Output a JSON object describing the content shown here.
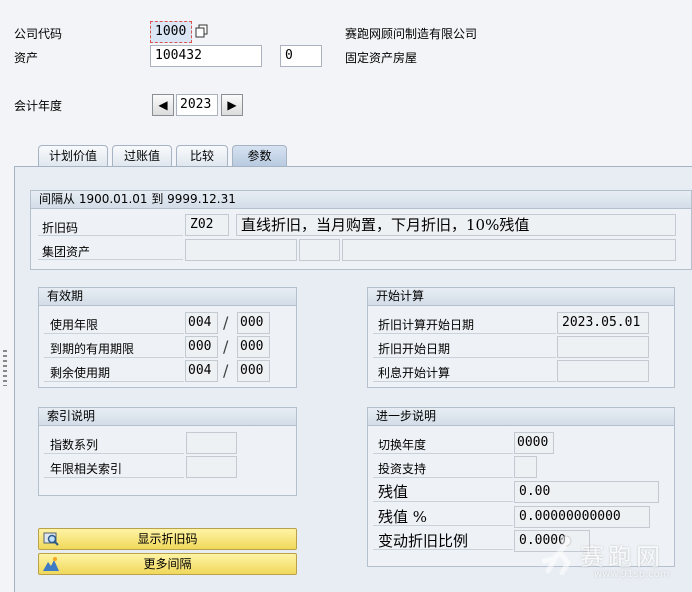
{
  "header": {
    "company_code_label": "公司代码",
    "company_code_value": "1000",
    "company_name": "赛跑网顾问制造有限公司",
    "asset_label": "资产",
    "asset_value": "100432",
    "asset_sub_value": "0",
    "asset_description": "固定资产房屋",
    "fiscal_year_label": "会计年度",
    "fiscal_year_value": "2023",
    "prev_arrow": "◀",
    "next_arrow": "▶"
  },
  "tabs": [
    {
      "label": "计划价值",
      "active": false
    },
    {
      "label": "过账值",
      "active": false
    },
    {
      "label": "比较",
      "active": false
    },
    {
      "label": "参数",
      "active": true
    }
  ],
  "interval": {
    "title": "间隔从 1900.01.01 到 9999.12.31",
    "depr_key_label": "折旧码",
    "depr_key_value": "Z02",
    "depr_key_desc": "直线折旧，当月购置，下月折旧，10%残值",
    "group_asset_label": "集团资产"
  },
  "validity": {
    "title": "有效期",
    "rows": [
      {
        "label": "使用年限",
        "years": "004",
        "periods": "000"
      },
      {
        "label": "到期的有用期限",
        "years": "000",
        "periods": "000"
      },
      {
        "label": "剩余使用期",
        "years": "004",
        "periods": "000"
      }
    ],
    "separator": "/"
  },
  "start_calc": {
    "title": "开始计算",
    "rows": [
      {
        "label": "折旧计算开始日期",
        "value": "2023.05.01"
      },
      {
        "label": "折旧开始日期",
        "value": ""
      },
      {
        "label": "利息开始计算",
        "value": ""
      }
    ]
  },
  "index": {
    "title": "索引说明",
    "rows": [
      {
        "label": "指数系列",
        "value": ""
      },
      {
        "label": "年限相关索引",
        "value": ""
      }
    ]
  },
  "further": {
    "title": "进一步说明",
    "switch_year_label": "切换年度",
    "switch_year_value": "0000",
    "investment_label": "投资支持",
    "residual_label": "残值",
    "residual_value": "0.00",
    "residual_pct_label": "残值 %",
    "residual_pct_value": "0.00000000000",
    "var_depr_label": "变动折旧比例",
    "var_depr_value": "0.0000"
  },
  "buttons": {
    "show_depr_key": "显示折旧码",
    "more_intervals": "更多间隔"
  },
  "watermark": {
    "brand": "赛跑网",
    "url": "www.91sp.com"
  }
}
